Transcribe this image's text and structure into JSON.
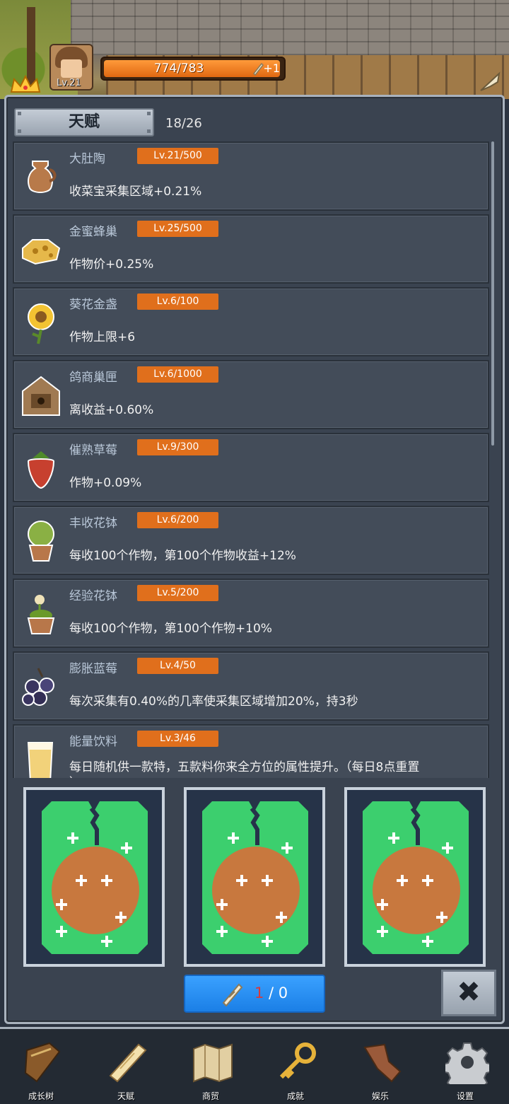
{
  "player": {
    "level_label": "Lv.21",
    "xp_text": "774/783",
    "xp_progress": 0.989,
    "scroll_bonus": "+1"
  },
  "talent_panel": {
    "title": "天赋",
    "count": "18/26",
    "items": [
      {
        "name": "大肚陶",
        "level": "Lv.21/500",
        "desc": "收菜宝采集区域+0.21%",
        "icon": "clay-jug-icon"
      },
      {
        "name": "金蜜蜂巢",
        "level": "Lv.25/500",
        "desc": "作物价+0.25%",
        "icon": "honeycomb-icon"
      },
      {
        "name": "葵花金盏",
        "level": "Lv.6/100",
        "desc": "作物上限+6",
        "icon": "sunflower-icon"
      },
      {
        "name": "鸽商巢匣",
        "level": "Lv.6/1000",
        "desc": "离收益+0.60%",
        "icon": "birdhouse-icon"
      },
      {
        "name": "催熟草莓",
        "level": "Lv.9/300",
        "desc": "作物+0.09%",
        "icon": "strawberry-icon"
      },
      {
        "name": "丰收花钵",
        "level": "Lv.6/200",
        "desc": "每收100个作物，第100个作物收益+12%",
        "icon": "flower-pot-icon"
      },
      {
        "name": "经验花钵",
        "level": "Lv.5/200",
        "desc": "每收100个作物，第100个作物+10%",
        "icon": "exp-flower-pot-icon"
      },
      {
        "name": "膨胀蓝莓",
        "level": "Lv.4/50",
        "desc": "每次采集有0.40%的几率使采集区域增加20%，持3秒",
        "icon": "blueberry-icon"
      },
      {
        "name": "能量饮料",
        "level": "Lv.3/46",
        "desc": "每日随机供一款特，五款料你来全方位的属性提升。（每日8点重置",
        "desc2": "）",
        "icon": "energy-drink-icon"
      }
    ]
  },
  "draw": {
    "owned": "1",
    "rest": "/ 0",
    "close_glyph": "✖"
  },
  "colors": {
    "level_badge": "#e06f1c",
    "card_green": "#3ccf6e",
    "card_orange": "#c8783e",
    "draw_button": "#2a8ff2"
  },
  "nav": [
    {
      "label": "成长树",
      "icon": "book-icon"
    },
    {
      "label": "天赋",
      "icon": "scroll-icon"
    },
    {
      "label": "商贸",
      "icon": "map-icon"
    },
    {
      "label": "成就",
      "icon": "key-icon"
    },
    {
      "label": "娱乐",
      "icon": "leaf-icon"
    },
    {
      "label": "设置",
      "icon": "gear-icon"
    }
  ]
}
